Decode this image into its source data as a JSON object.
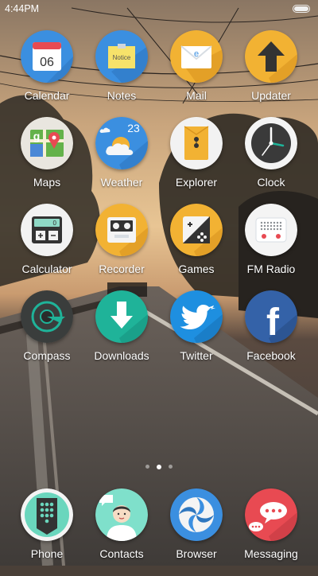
{
  "status": {
    "time": "4:44PM"
  },
  "apps": {
    "calendar": {
      "label": "Calendar",
      "date": "06"
    },
    "notes": {
      "label": "Notes",
      "sticky": "Notice"
    },
    "mail": {
      "label": "Mail",
      "glyph": "e"
    },
    "updater": {
      "label": "Updater"
    },
    "maps": {
      "label": "Maps"
    },
    "weather": {
      "label": "Weather",
      "temp": "23"
    },
    "explorer": {
      "label": "Explorer"
    },
    "clock": {
      "label": "Clock"
    },
    "calculator": {
      "label": "Calculator",
      "display": "0"
    },
    "recorder": {
      "label": "Recorder"
    },
    "games": {
      "label": "Games"
    },
    "fmradio": {
      "label": "FM Radio"
    },
    "compass": {
      "label": "Compass"
    },
    "downloads": {
      "label": "Downloads"
    },
    "twitter": {
      "label": "Twitter"
    },
    "facebook": {
      "label": "Facebook",
      "glyph": "f"
    }
  },
  "dock": {
    "phone": {
      "label": "Phone"
    },
    "contacts": {
      "label": "Contacts"
    },
    "browser": {
      "label": "Browser"
    },
    "messaging": {
      "label": "Messaging"
    }
  },
  "pager": {
    "pages": 3,
    "current": 2
  },
  "colors": {
    "calendar_bg": "#3b8fe0",
    "notes_bg": "#3b8fe0",
    "mail_bg": "#f2b233",
    "updater_bg": "#f2b233",
    "weather_bg": "#3b8fe0",
    "explorer_bg": "#f2f2f2",
    "recorder_bg": "#f2b233",
    "games_bg": "#f2b233",
    "downloads_bg": "#1fb399",
    "twitter_bg": "#1e8fe0",
    "facebook_bg": "#3462a8",
    "phone_bg": "#6ad6bd",
    "contacts_bg": "#7fe0cb",
    "browser_bg": "#3b8fe0",
    "messaging_bg": "#e84a52"
  }
}
